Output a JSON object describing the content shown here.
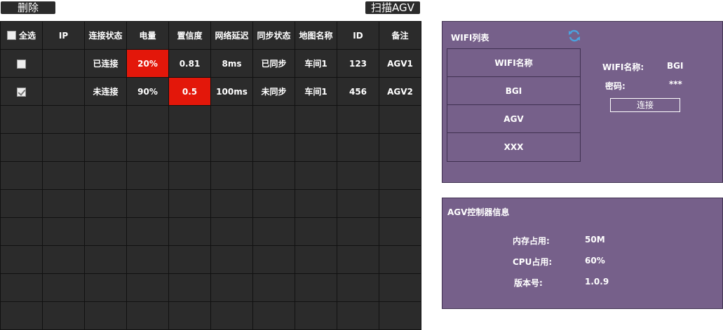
{
  "toolbar": {
    "delete_label": "删除",
    "scan_label": "扫描AGV"
  },
  "table": {
    "select_all_label": "全选",
    "headers": [
      "IP",
      "连接状态",
      "电量",
      "置信度",
      "网络延迟",
      "同步状态",
      "地图名称",
      "ID",
      "备注"
    ],
    "rows": [
      {
        "checked": false,
        "ip": "",
        "status": "已连接",
        "battery": "20%",
        "confidence": "0.81",
        "latency": "8ms",
        "sync": "已同步",
        "map": "车间1",
        "id": "123",
        "note": "AGV1"
      },
      {
        "checked": true,
        "ip": "",
        "status": "未连接",
        "battery": "90%",
        "confidence": "0.5",
        "latency": "100ms",
        "sync": "未同步",
        "map": "车间1",
        "id": "456",
        "note": "AGV2"
      }
    ],
    "alert_color": "#e3170a"
  },
  "wifi": {
    "title": "WIFI列表",
    "list_header": "WIFI名称",
    "networks": [
      "BGI",
      "AGV",
      "XXX"
    ],
    "name_label": "WIFI名称:",
    "name_value": "BGI",
    "password_label": "密码:",
    "password_value": "***",
    "connect_label": "连接"
  },
  "controller": {
    "title": "AGV控制器信息",
    "memory_label": "内存占用:",
    "memory_value": "50M",
    "cpu_label": "CPU占用:",
    "cpu_value": "60%",
    "version_label": "版本号:",
    "version_value": "1.0.9"
  },
  "colors": {
    "panel_bg": "#76608a",
    "table_bg": "#2b2b2b",
    "accent_icon": "#4aa3df"
  }
}
